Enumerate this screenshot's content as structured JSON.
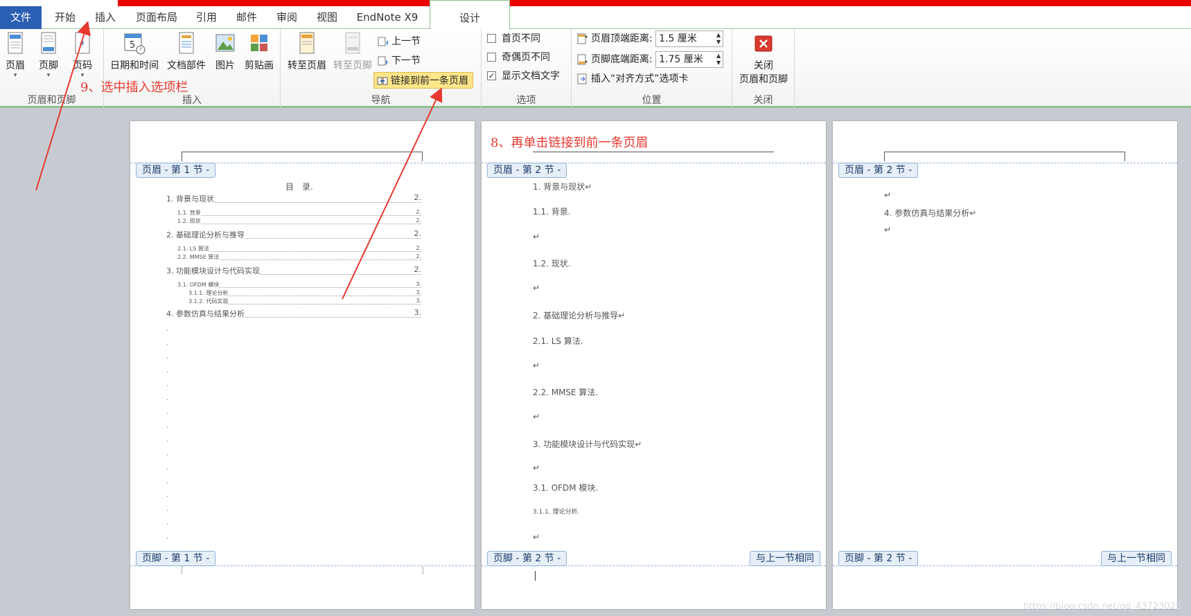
{
  "tabs": {
    "file": "文件",
    "home": "开始",
    "insert": "插入",
    "layout": "页面布局",
    "references": "引用",
    "mailings": "邮件",
    "review": "审阅",
    "view": "视图",
    "endnote": "EndNote X9",
    "design": "设计"
  },
  "ribbon": {
    "hf_group": {
      "label": "页眉和页脚",
      "header": "页眉",
      "footer": "页脚",
      "page_number": "页码"
    },
    "insert_group": {
      "label": "插入",
      "datetime": "日期和时间",
      "docparts": "文档部件",
      "picture": "图片",
      "clipart": "剪贴画"
    },
    "nav_group": {
      "label": "导航",
      "goto_header": "转至页眉",
      "goto_footer": "转至页脚",
      "prev": "上一节",
      "next": "下一节",
      "link_prev": "链接到前一条页眉"
    },
    "options_group": {
      "label": "选项",
      "diff_first": "首页不同",
      "diff_odd_even": "奇偶页不同",
      "show_doc_text": "显示文档文字",
      "show_doc_text_checked": true
    },
    "position_group": {
      "label": "位置",
      "header_top": "页眉顶端距离:",
      "header_top_val": "1.5 厘米",
      "footer_bottom": "页脚底端距离:",
      "footer_bottom_val": "1.75 厘米",
      "insert_align": "插入“对齐方式”选项卡"
    },
    "close_group": {
      "label": "关闭",
      "close_line1": "关闭",
      "close_line2": "页眉和页脚"
    }
  },
  "pages": [
    {
      "header_tag": "页眉 - 第 1 节 -",
      "footer_tag": "页脚 - 第 1 节 -",
      "toc_title": "目　录.",
      "toc": [
        {
          "text": "1. 背景与现状",
          "page": "2.",
          "level": 1
        },
        {
          "text": "1.1. 背景",
          "page": "2.",
          "level": 2
        },
        {
          "text": "1.2. 现状",
          "page": "2.",
          "level": 2
        },
        {
          "text": "2. 基础理论分析与推导",
          "page": "2.",
          "level": 1
        },
        {
          "text": "2.1. LS 算法",
          "page": "2.",
          "level": 2
        },
        {
          "text": "2.2. MMSE 算法",
          "page": "2.",
          "level": 2
        },
        {
          "text": "3. 功能模块设计与代码实现",
          "page": "2.",
          "level": 1
        },
        {
          "text": "3.1. OFDM 模块",
          "page": "3.",
          "level": 2
        },
        {
          "text": "3.1.1. 理论分析",
          "page": "3.",
          "level": 3
        },
        {
          "text": "3.1.2. 代码实现",
          "page": "3.",
          "level": 3
        },
        {
          "text": "4. 参数仿真与结果分析",
          "page": "3.",
          "level": 1
        }
      ]
    },
    {
      "header_tag": "页眉 - 第 2 节 -",
      "footer_tag": "页脚 - 第 2 节 -",
      "same_as_prev": "与上一节相同",
      "lines": [
        "1. 背景与现状↵",
        "1.1. 背景.",
        "↵",
        "1.2. 现状.",
        "↵",
        "2. 基础理论分析与推导↵",
        "2.1. LS 算法.",
        "↵",
        "2.2. MMSE 算法.",
        "↵",
        "3. 功能模块设计与代码实现↵",
        "↵",
        "3.1. OFDM 模块.",
        "3.1.1. 理论分析.",
        "↵"
      ]
    },
    {
      "header_tag": "页眉 - 第 2 节 -",
      "footer_tag": "页脚 - 第 2 节 -",
      "same_as_prev": "与上一节相同",
      "lines": [
        "↵",
        "4. 参数仿真与结果分析↵",
        "↵"
      ]
    }
  ],
  "annotations": {
    "step9": "9、选中插入选项栏",
    "step8": "8、再单击链接到前一条页眉"
  },
  "watermark": "https://blog.csdn.net/qq_43723025",
  "colors": {
    "file_tab": "#2b5fb4",
    "annotation": "#e8382f",
    "context_header": "#c8a84a",
    "highlight": "#fde58a"
  }
}
